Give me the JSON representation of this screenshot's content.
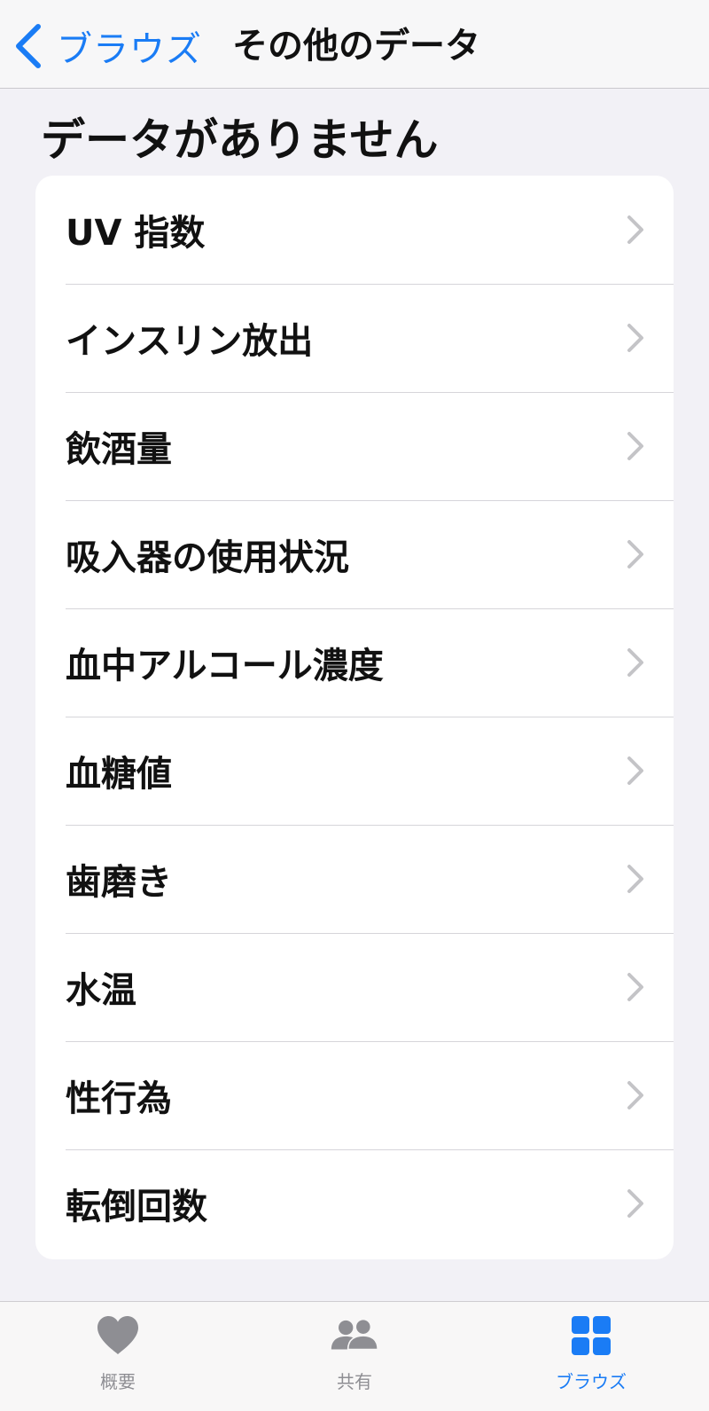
{
  "nav": {
    "back_label": "ブラウズ",
    "title": "その他のデータ"
  },
  "section": {
    "heading": "データがありません"
  },
  "items": [
    {
      "label": "UV 指数"
    },
    {
      "label": "インスリン放出"
    },
    {
      "label": "飲酒量"
    },
    {
      "label": "吸入器の使用状況"
    },
    {
      "label": "血中アルコール濃度"
    },
    {
      "label": "血糖値"
    },
    {
      "label": "歯磨き"
    },
    {
      "label": "水温"
    },
    {
      "label": "性行為"
    },
    {
      "label": "転倒回数"
    }
  ],
  "tabs": [
    {
      "label": "概要",
      "icon": "heart-icon",
      "active": false
    },
    {
      "label": "共有",
      "icon": "people-icon",
      "active": false
    },
    {
      "label": "ブラウズ",
      "icon": "grid-icon",
      "active": true
    }
  ],
  "colors": {
    "accent": "#1a7cf5",
    "background": "#f2f1f6",
    "card": "#ffffff",
    "chevron": "#c4c4c7",
    "tab_inactive": "#8e8e93"
  }
}
